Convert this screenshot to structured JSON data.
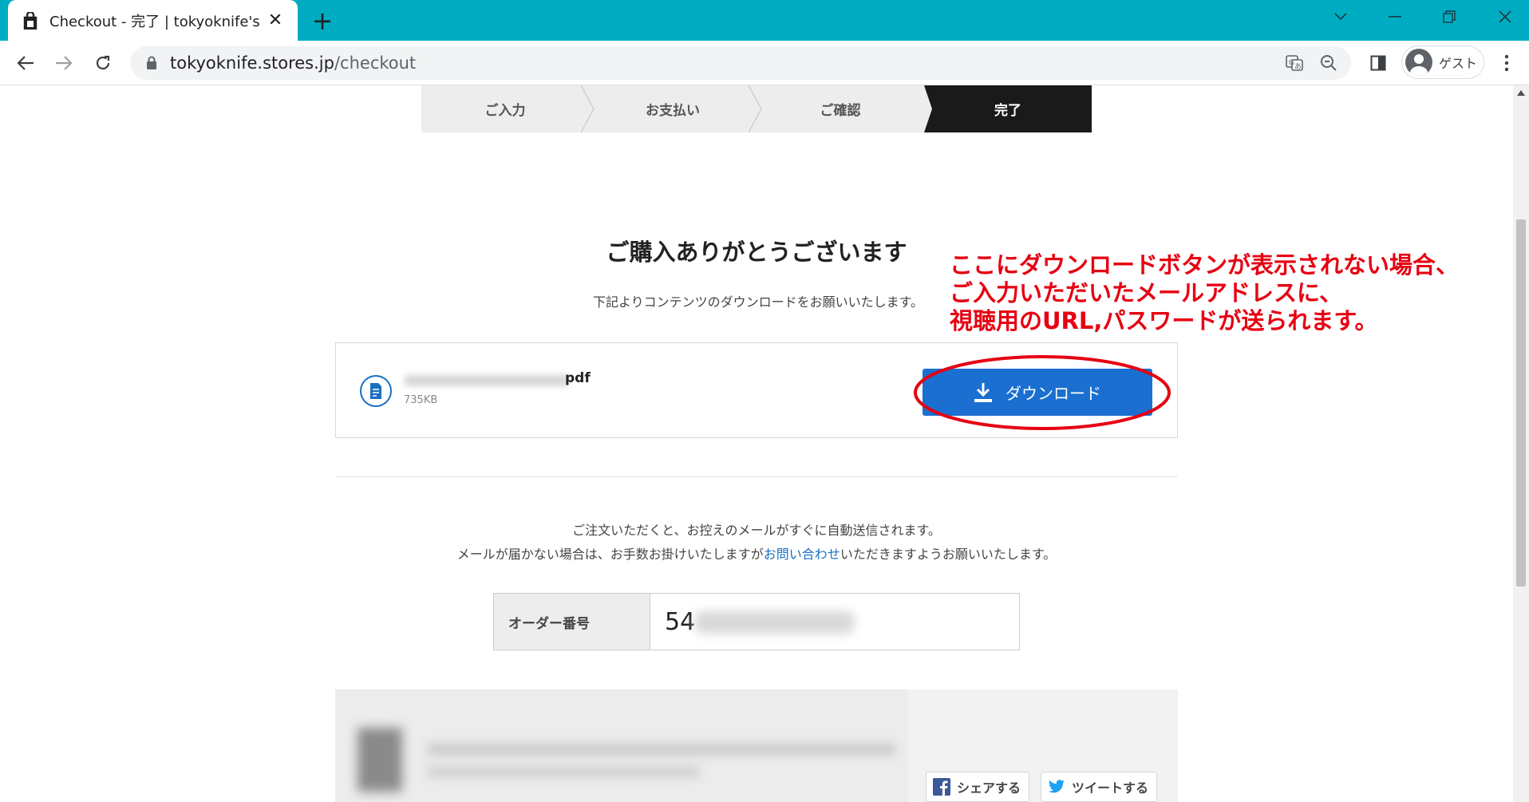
{
  "browser": {
    "tab_title": "Checkout - 完了 | tokyoknife's ST",
    "url_host": "tokyoknife.stores.jp",
    "url_path": "/checkout",
    "profile_label": "ゲスト"
  },
  "steps": [
    "ご入力",
    "お支払い",
    "ご確認",
    "完了"
  ],
  "active_step": 3,
  "heading": "ご購入ありがとうございます",
  "subheading": "下記よりコンテンツのダウンロードをお願いいたします。",
  "download": {
    "file_ext": "pdf",
    "file_size": "735KB",
    "button_label": "ダウンロード"
  },
  "annotation": {
    "text": "ここにダウンロードボタンが表示されない場合、\nご入力いただいたメールアドレスに、\n視聴用のURL,パスワードが送られます。",
    "color": "#e60012"
  },
  "notice": {
    "line1": "ご注文いただくと、お控えのメールがすぐに自動送信されます。",
    "line2_before": "メールが届かない場合は、お手数お掛けいたしますが",
    "line2_link": "お問い合わせ",
    "line2_after": "いただきますようお願いいたします。"
  },
  "order": {
    "label": "オーダー番号",
    "value_visible": "54"
  },
  "share": {
    "facebook_label": "シェアする",
    "twitter_label": "ツイートする"
  },
  "colors": {
    "tabbar": "#00acc1",
    "download_button": "#1a6fd1",
    "active_step": "#1a1a1a",
    "link": "#1a6fc0"
  }
}
